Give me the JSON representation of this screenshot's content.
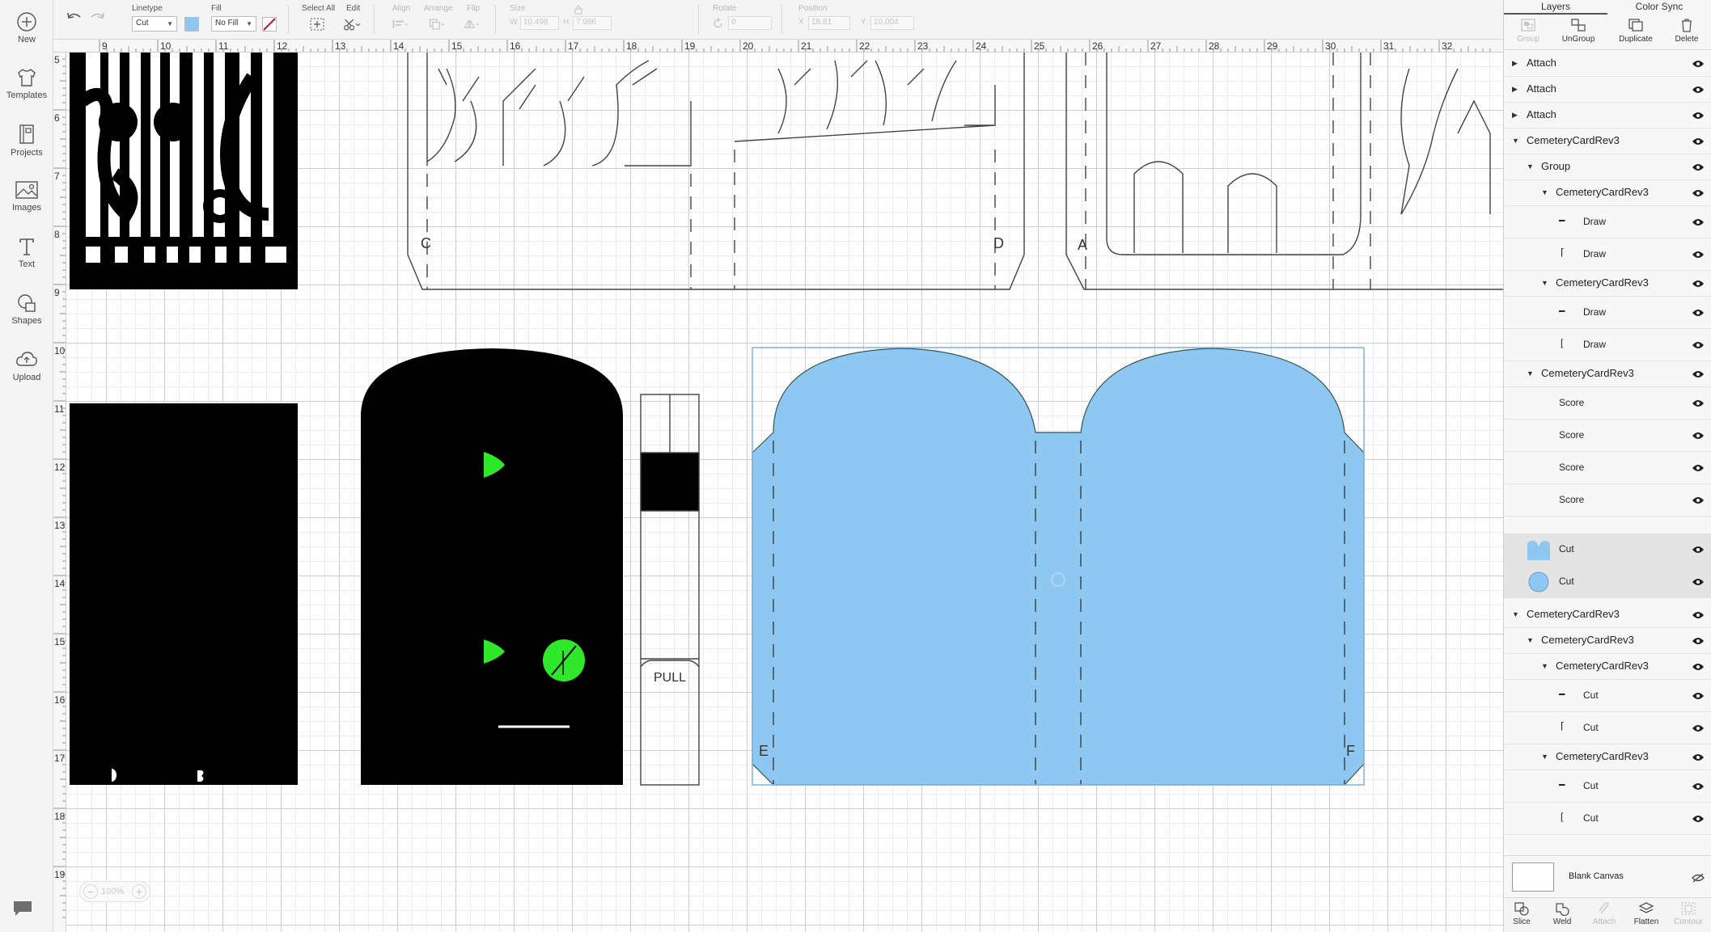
{
  "sidebar": {
    "items": [
      {
        "label": "New",
        "icon": "plus-circle-icon"
      },
      {
        "label": "Templates",
        "icon": "tshirt-icon"
      },
      {
        "label": "Projects",
        "icon": "projects-icon"
      },
      {
        "label": "Images",
        "icon": "image-icon"
      },
      {
        "label": "Text",
        "icon": "text-icon"
      },
      {
        "label": "Shapes",
        "icon": "shapes-icon"
      },
      {
        "label": "Upload",
        "icon": "upload-icon"
      }
    ]
  },
  "toolbar": {
    "linetype_label": "Linetype",
    "linetype_value": "Cut",
    "fill_label": "Fill",
    "fill_value": "No Fill",
    "fill_color": "#8ec8f2",
    "select_all_label": "Select All",
    "edit_label": "Edit",
    "align_label": "Align",
    "arrange_label": "Arrange",
    "flip_label": "Flip",
    "size_label": "Size",
    "w_label": "W",
    "w_value": "10.498",
    "h_label": "H",
    "h_value": "7.986",
    "rotate_label": "Rotate",
    "rotate_value": "0",
    "position_label": "Position",
    "x_label": "X",
    "x_value": "18.81",
    "y_label": "Y",
    "y_value": "10.004"
  },
  "rulers": {
    "top": [
      "9",
      "10",
      "11",
      "12",
      "13",
      "14",
      "15",
      "16",
      "17",
      "18",
      "19",
      "20",
      "21",
      "22",
      "23",
      "24",
      "25",
      "26",
      "27",
      "28",
      "29",
      "30",
      "31",
      "32"
    ],
    "left": [
      "5",
      "6",
      "7",
      "8",
      "9",
      "10",
      "11",
      "12",
      "13",
      "14",
      "15",
      "16",
      "17",
      "18",
      "19"
    ]
  },
  "canvas": {
    "letters": [
      "C",
      "D",
      "A",
      "E",
      "F"
    ],
    "pull_label": "PULL",
    "zoom": "100%",
    "accent": "#8ec8f2",
    "green": "#2fe829"
  },
  "panel": {
    "tabs": [
      "Layers",
      "Color Sync"
    ],
    "actions": [
      "Group",
      "UnGroup",
      "Duplicate",
      "Delete"
    ],
    "layers": [
      {
        "name": "Attach"
      },
      {
        "name": "Attach"
      },
      {
        "name": "Attach"
      },
      {
        "name": "CemeteryCardRev3"
      },
      {
        "name": "Group"
      },
      {
        "name": "CemeteryCardRev3"
      },
      {
        "name": "Draw"
      },
      {
        "name": "Draw"
      },
      {
        "name": "CemeteryCardRev3"
      },
      {
        "name": "Draw"
      },
      {
        "name": "Draw"
      },
      {
        "name": "CemeteryCardRev3"
      },
      {
        "name": "Score"
      },
      {
        "name": "Score"
      },
      {
        "name": "Score"
      },
      {
        "name": "Score"
      },
      {
        "name": "Cut"
      },
      {
        "name": "Cut"
      },
      {
        "name": "CemeteryCardRev3"
      },
      {
        "name": "CemeteryCardRev3"
      },
      {
        "name": "CemeteryCardRev3"
      },
      {
        "name": "Cut"
      },
      {
        "name": "Cut"
      },
      {
        "name": "CemeteryCardRev3"
      },
      {
        "name": "Cut"
      },
      {
        "name": "Cut"
      }
    ],
    "blank_canvas": "Blank Canvas",
    "bottom_actions": [
      "Slice",
      "Weld",
      "Attach",
      "Flatten",
      "Contour"
    ]
  }
}
